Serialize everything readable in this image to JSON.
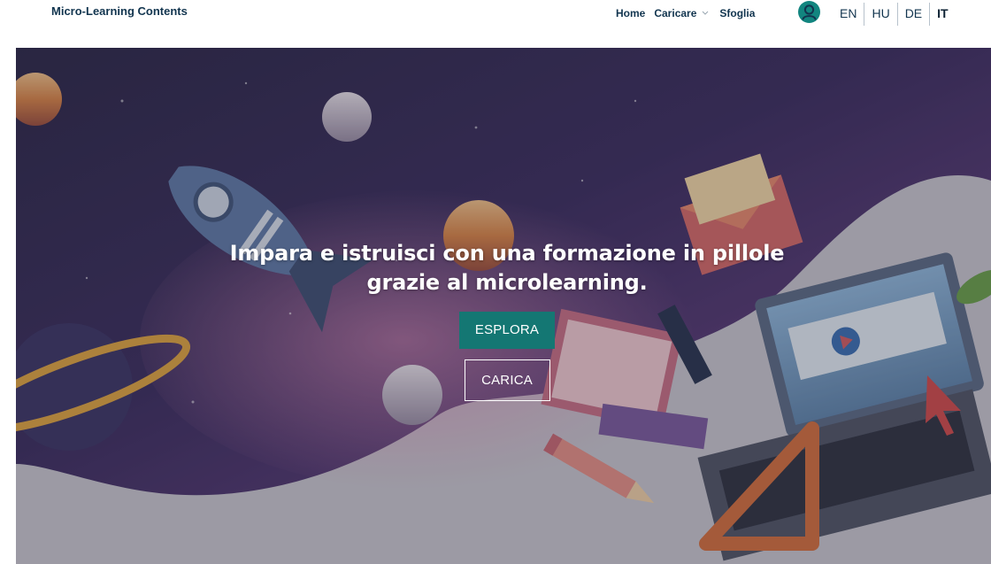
{
  "navbar": {
    "brand": "Micro-Learning Contents",
    "links": {
      "home": "Home",
      "upload": "Caricare",
      "browse": "Sfoglia"
    },
    "user_icon": "user-account-icon",
    "languages": [
      "EN",
      "HU",
      "DE",
      "IT"
    ],
    "active_language": "IT"
  },
  "hero": {
    "title_line1": "Impara e istruisci con una formazione in pillole",
    "title_line2": "grazie al microlearning.",
    "explore_label": "ESPLORA",
    "upload_label": "CARICA"
  },
  "colors": {
    "brand_text": "#12354f",
    "primary_button": "#147773",
    "hero_dark": "#2e2752"
  }
}
